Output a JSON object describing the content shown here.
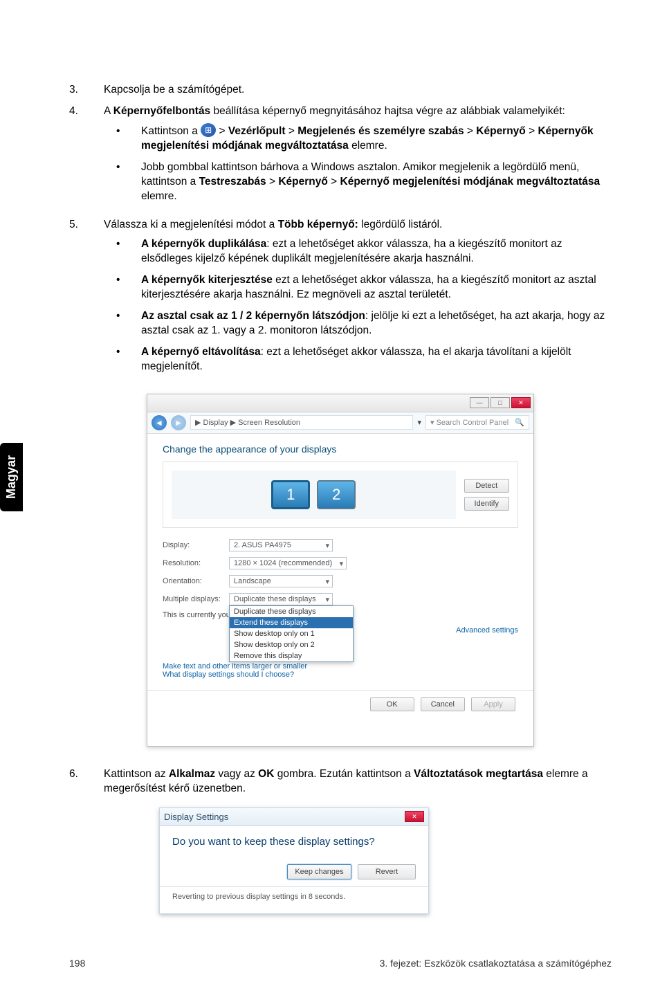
{
  "sideTab": "Magyar",
  "steps": {
    "s3": {
      "num": "3.",
      "text": "Kapcsolja be a számítógépet."
    },
    "s4": {
      "num": "4.",
      "lead_a": "A ",
      "lead_b": "Képernyőfelbontás",
      "lead_c": " beállítása képernyő megnyitásához hajtsa végre az alábbiak valamelyikét:",
      "b1": {
        "a": "Kattintson a ",
        "p1": "Vezérlőpult",
        "p2": "Megjelenés és személyre szabás",
        "p3": "Képernyő",
        "p4": "Képernyők megjelenítési módjának megváltoztatása",
        "tail": " elemre."
      },
      "b2": {
        "a": "Jobb gombbal kattintson bárhova a Windows asztalon. Amikor megjelenik a legördülő menü, kattintson a ",
        "p1": "Testreszabás",
        "p2": "Képernyő",
        "p3": "Képernyő megjelenítési módjának megváltoztatása",
        "tail": " elemre."
      }
    },
    "s5": {
      "num": "5.",
      "lead_a": "Válassza ki a megjelenítési módot a ",
      "lead_b": "Több képernyő:",
      "lead_c": " legördülő listáról.",
      "o1": {
        "t": "A képernyők duplikálása",
        "d": ": ezt a lehetőséget akkor válassza, ha a kiegészítő monitort az elsődleges kijelző képének duplikált megjelenítésére akarja használni."
      },
      "o2": {
        "t": "A képernyők kiterjesztése",
        "d": " ezt a lehetőséget akkor válassza, ha a kiegészítő monitort az asztal kiterjesztésére akarja használni. Ez megnöveli az asztal területét."
      },
      "o3": {
        "t": "Az asztal csak az 1 / 2 képernyőn látszódjon",
        "d": ": jelölje ki ezt a lehetőséget, ha azt akarja, hogy az asztal csak az 1. vagy a 2. monitoron látszódjon."
      },
      "o4": {
        "t": "A képernyő eltávolítása",
        "d": ": ezt a lehetőséget akkor válassza, ha el akarja távolítani a kijelölt megjelenítőt."
      }
    },
    "s6": {
      "num": "6.",
      "a": "Kattintson az ",
      "b1": "Alkalmaz",
      "mid": " vagy az ",
      "b2": "OK",
      "c": " gombra. Ezután kattintson a ",
      "b3": "Változtatások megtartása",
      "d": " elemre a megerősítést kérő üzenetben."
    }
  },
  "shot1": {
    "breadcrumb": "▶ Display ▶ Screen Resolution",
    "search": "Search Control Panel",
    "heading": "Change the appearance of your displays",
    "mon1": "1",
    "mon2": "2",
    "detect": "Detect",
    "identify": "Identify",
    "labels": {
      "display": "Display:",
      "resolution": "Resolution:",
      "orientation": "Orientation:",
      "multiple": "Multiple displays:"
    },
    "values": {
      "display": "2. ASUS PA4975",
      "resolution": "1280 × 1024 (recommended)",
      "orientation": "Landscape",
      "multiple": "Duplicate these displays"
    },
    "dropdown": {
      "i0": "Duplicate these displays",
      "i1": "Extend these displays",
      "i2": "Show desktop only on 1",
      "i3": "Show desktop only on 2",
      "i4": "Remove this display"
    },
    "note": "This is currently your main display",
    "adv": "Advanced settings",
    "link1": "Make text and other items larger or smaller",
    "link2": "What display settings should I choose?",
    "ok": "OK",
    "cancel": "Cancel",
    "apply": "Apply"
  },
  "shot2": {
    "title": "Display Settings",
    "question": "Do you want to keep these display settings?",
    "keep": "Keep changes",
    "revert": "Revert",
    "reverting": "Reverting to previous display settings in 8 seconds."
  },
  "footer": {
    "page": "198",
    "chapter": "3. fejezet: Eszközök csatlakoztatása a számítógéphez"
  }
}
